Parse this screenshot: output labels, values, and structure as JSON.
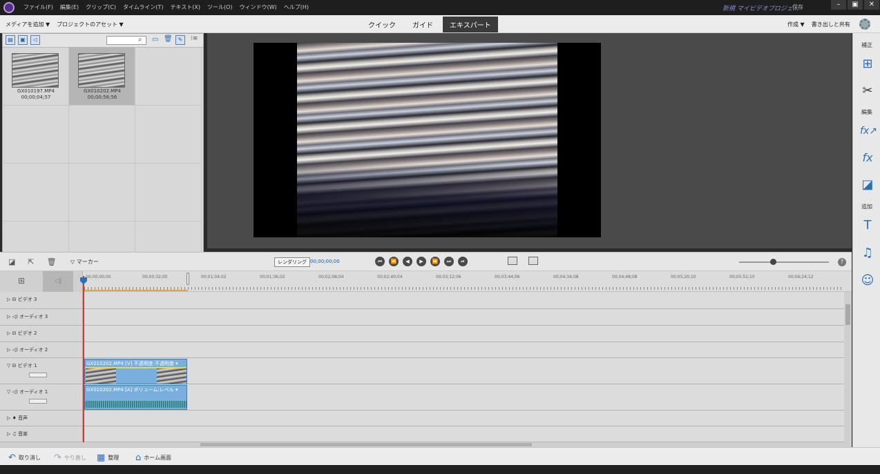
{
  "titlebar": {
    "menu": [
      "ファイル(F)",
      "編集(E)",
      "クリップ(C)",
      "タイムライン(T)",
      "テキスト(X)",
      "ツール(O)",
      "ウィンドウ(W)",
      "ヘルプ(H)"
    ],
    "project_name": "新規 マイビデオプロジェ...",
    "save_label": "保存",
    "win_buttons": [
      "–",
      "▣",
      "✕"
    ]
  },
  "modebar": {
    "add_media": "メディアを追加 ▼",
    "project_assets": "プロジェクトのアセット ▼",
    "modes": [
      "クイック",
      "ガイド",
      "エキスパート"
    ],
    "active_mode": "エキスパート",
    "create": "作成 ▼",
    "export_share": "書き出しと共有"
  },
  "right_panel": {
    "sections": [
      "補正",
      "編集",
      "追加"
    ],
    "icons": [
      "adjust-icon",
      "tools-icon",
      "applied-effects-icon",
      "effects-icon",
      "transitions-icon",
      "titles-icon",
      "music-icon",
      "graphics-icon"
    ]
  },
  "media_panel": {
    "items": [
      {
        "name": "GX010197.MP4",
        "duration": "00;00;04;57"
      },
      {
        "name": "GX010202.MP4",
        "duration": "00;00;56;56"
      }
    ]
  },
  "timeline_header": {
    "marker": "▽ マーカー",
    "render": "レンダリング",
    "timecode": "00;00;00;00",
    "transport": [
      "⏮",
      "⏪",
      "◀",
      "▶",
      "⏩",
      "⏭",
      "⏯"
    ]
  },
  "ruler": {
    "ticks": [
      "00;00;00;00",
      "00;00;32;00",
      "00;01;04;02",
      "00;01;36;02",
      "00;02;08;04",
      "00;02;40;04",
      "00;03;12;06",
      "00;03;44;06",
      "00;04;16;08",
      "00;04;48;08",
      "00;05;20;10",
      "00;05;52;10",
      "00;06;24;12"
    ]
  },
  "tracks": [
    {
      "label": "ビデオ 3",
      "icon": "▷ ⊟"
    },
    {
      "label": "オーディオ 3",
      "icon": "▷ ◁)"
    },
    {
      "label": "ビデオ 2",
      "icon": "▷ ⊟"
    },
    {
      "label": "オーディオ 2",
      "icon": "▷ ◁)"
    },
    {
      "label": "ビデオ 1",
      "icon": "▽ ⊟"
    },
    {
      "label": "オーディオ 1",
      "icon": "▽ ◁)"
    },
    {
      "label": "音声",
      "icon": "▷ ♦"
    },
    {
      "label": "音楽",
      "icon": "▷ ♫"
    }
  ],
  "clips": {
    "video": "GX010202.MP4 [V] 不透明度:不透明度 ▾",
    "audio": "GX010202.MP4 [A] ボリューム:レベル ▾"
  },
  "bottombar": {
    "undo": "取り消し",
    "redo": "やり直し",
    "organize": "整理",
    "home": "ホーム画面"
  }
}
